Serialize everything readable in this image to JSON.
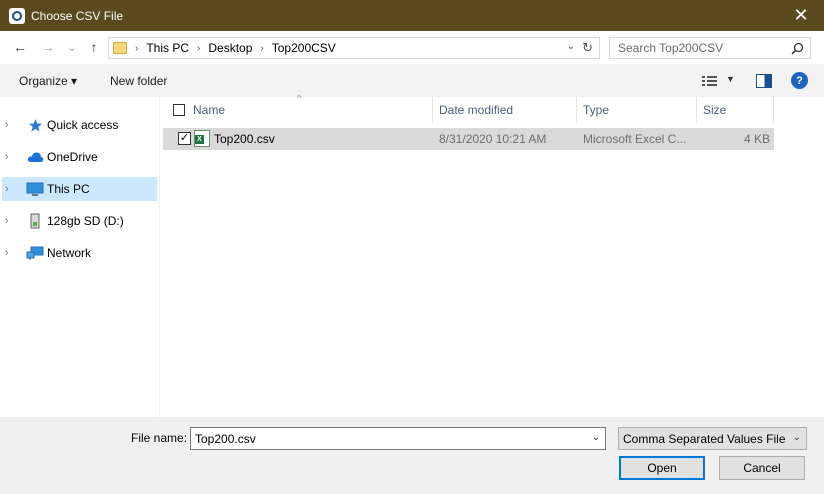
{
  "window": {
    "title": "Choose CSV File",
    "close_glyph": "✕"
  },
  "nav": {
    "back_glyph": "←",
    "forward_glyph": "→",
    "recent_glyph": "⌄",
    "up_glyph": "↑",
    "breadcrumbs": [
      "This PC",
      "Desktop",
      "Top200CSV"
    ],
    "crumb_separator": "›",
    "address_dropdown_glyph": "⌄",
    "refresh_glyph": "↻",
    "search_placeholder": "Search Top200CSV"
  },
  "toolbar": {
    "organize_label": "Organize ▾",
    "new_folder_label": "New folder",
    "view_dropdown_glyph": "▼",
    "help_glyph": "?"
  },
  "sidebar": {
    "items": [
      {
        "label": "Quick access",
        "icon": "star-icon",
        "chevron": "›"
      },
      {
        "label": "OneDrive",
        "icon": "cloud-icon",
        "chevron": "›"
      },
      {
        "label": "This PC",
        "icon": "computer-icon",
        "chevron": "›"
      },
      {
        "label": "128gb SD (D:)",
        "icon": "drive-icon",
        "chevron": "›"
      },
      {
        "label": "Network",
        "icon": "network-icon",
        "chevron": "›"
      }
    ]
  },
  "file_list": {
    "columns": [
      "Name",
      "Date modified",
      "Type",
      "Size"
    ],
    "sort_glyph": "^",
    "rows": [
      {
        "name": "Top200.csv",
        "date_modified": "8/31/2020 10:21 AM",
        "type": "Microsoft Excel C...",
        "size": "4 KB",
        "checked_glyph": "✓"
      }
    ]
  },
  "bottom": {
    "file_name_label": "File name:",
    "file_name_value": "Top200.csv",
    "file_type_value": "Comma Separated Values File (*.csv)",
    "dropdown_glyph": "⌄",
    "open_label": "Open",
    "cancel_label": "Cancel"
  },
  "colors": {
    "titlebar": "#5a4a1e",
    "selection": "#cce8ff",
    "row_selected": "#d9d9d9",
    "accent": "#0078d7"
  }
}
